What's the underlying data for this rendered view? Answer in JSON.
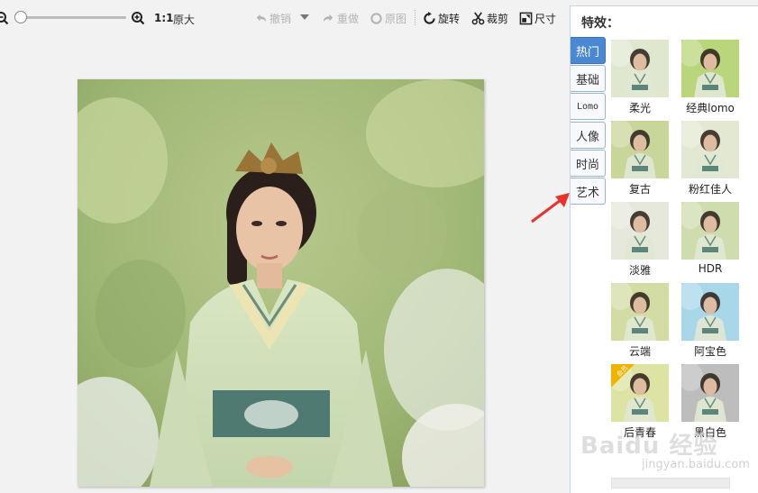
{
  "toolbar": {
    "zoom": {
      "ratio": "1:1",
      "actual_size": "原大",
      "slider_value": 0.0
    },
    "undo": "撤销",
    "redo": "重做",
    "original": "原图",
    "rotate": "旋转",
    "crop": "裁剪",
    "size": "尺寸"
  },
  "panel": {
    "title": "特效：",
    "categories": [
      {
        "label": "热门",
        "active": true
      },
      {
        "label": "基础",
        "active": false
      },
      {
        "label": "Lomo",
        "active": false
      },
      {
        "label": "人像",
        "active": false
      },
      {
        "label": "时尚",
        "active": false
      },
      {
        "label": "艺术",
        "active": false
      }
    ],
    "effects": [
      {
        "label": "柔光",
        "tint": "#dfe8cf"
      },
      {
        "label": "经典lomo",
        "tint": "#b9d67a"
      },
      {
        "label": "复古",
        "tint": "#c9d69a"
      },
      {
        "label": "粉红佳人",
        "tint": "#e2e8d2"
      },
      {
        "label": "淡雅",
        "tint": "#e6e8db"
      },
      {
        "label": "HDR",
        "tint": "#cfdcae"
      },
      {
        "label": "云端",
        "tint": "#d3dda3"
      },
      {
        "label": "阿宝色",
        "tint": "#a9d7ea"
      },
      {
        "label": "后青春",
        "tint": "#dde3a2",
        "badge": "会员"
      },
      {
        "label": "黑白色",
        "tint": "#bdbdbd"
      }
    ]
  },
  "watermark": {
    "logo": "Baidu 经验",
    "url": "jingyan.baidu.com"
  },
  "colors": {
    "accent": "#4a88d4",
    "annotation": "#e8322c"
  }
}
